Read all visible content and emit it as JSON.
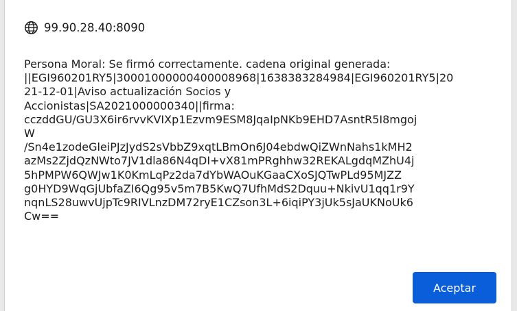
{
  "dialog": {
    "origin": "99.90.28.40:8090",
    "origin_icon": "globe-icon",
    "message": "Persona Moral: Se firmó correctamente. cadena original generada:\n||EGI960201RY5|30001000000400008968|1638383284984|EGI960201RY5|20\n21-12-01|Aviso actualización Socios y\nAccionistas|SA2021000000340||firma:\ncczddGU/GU3X6ir6rvvKVIXp1Ezvm9ESM8JqaIpNKb9EHD7AsntR5I8mgoj\nW\n/Sn4e1zodeGleiPJzJydS2sVbbZ9xqtLBmOn6J04ebdwQiZWnNahs1kMH2\nazMs2ZjdQzNWto7JV1dla86N4qDI+vX81mPRghhw32REKALgdqMZhU4j\n5hPMPW6QWJw1K0KmLqPz2da7dYbWAOuKGaaCXoSJQTwPLd95MJZZ\ng0HYD9WqGjUbfaZI6Qg95v5m7B5KwQ7UfhMdS2Dquu+NkivU1qq1r9Y\nnqnLS28uwvUjpTc9RIVLnzDM72ryE1CZson3L+6iqiPY3jUk5sJaUKNoUk6\nCw==",
    "accept_label": "Aceptar",
    "accent_color": "#0a5ed9"
  }
}
